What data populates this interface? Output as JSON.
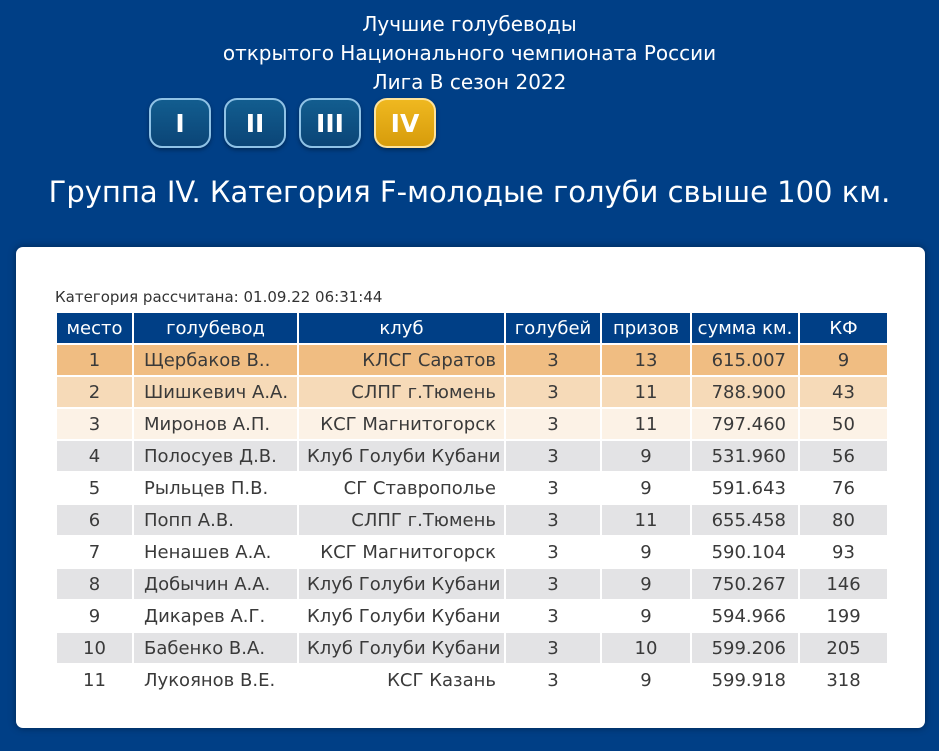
{
  "header": {
    "line1": "Лучшие голубеводы",
    "line2": "открытого Национального чемпионата России",
    "line3": "Лига В сезон 2022"
  },
  "groups": [
    {
      "label": "I",
      "active": false
    },
    {
      "label": "II",
      "active": false
    },
    {
      "label": "III",
      "active": false
    },
    {
      "label": "IV",
      "active": true
    }
  ],
  "subtitle": "Группа IV. Категория F-молодые голуби свыше 100 км.",
  "calculated": "Категория рассчитана: 01.09.22 06:31:44",
  "table": {
    "columns": [
      "место",
      "голубевод",
      "клуб",
      "голубей",
      "призов",
      "сумма км.",
      "КФ"
    ],
    "rows": [
      [
        "1",
        "Щербаков В..",
        "КЛСГ Саратов",
        "3",
        "13",
        "615.007",
        "9"
      ],
      [
        "2",
        "Шишкевич А.А.",
        "СЛПГ г.Тюмень",
        "3",
        "11",
        "788.900",
        "43"
      ],
      [
        "3",
        "Миронов А.П.",
        "КСГ Магнитогорск",
        "3",
        "11",
        "797.460",
        "50"
      ],
      [
        "4",
        "Полосуев Д.В.",
        "Клуб Голуби Кубани",
        "3",
        "9",
        "531.960",
        "56"
      ],
      [
        "5",
        "Рыльцев П.В.",
        "СГ Ставрополье",
        "3",
        "9",
        "591.643",
        "76"
      ],
      [
        "6",
        "Попп А.В.",
        "СЛПГ г.Тюмень",
        "3",
        "11",
        "655.458",
        "80"
      ],
      [
        "7",
        "Ненашев А.А.",
        "КСГ Магнитогорск",
        "3",
        "9",
        "590.104",
        "93"
      ],
      [
        "8",
        "Добычин А.А.",
        "Клуб Голуби Кубани",
        "3",
        "9",
        "750.267",
        "146"
      ],
      [
        "9",
        "Дикарев А.Г.",
        "Клуб Голуби Кубани",
        "3",
        "9",
        "594.966",
        "199"
      ],
      [
        "10",
        "Бабенко В.А.",
        "Клуб Голуби Кубани",
        "3",
        "10",
        "599.206",
        "205"
      ],
      [
        "11",
        "Лукоянов В.Е.",
        "КСГ Казань",
        "3",
        "9",
        "599.918",
        "318"
      ]
    ]
  },
  "colors": {
    "background": "#003f86",
    "active_group": "#e3a912",
    "row1": "#f0bd82",
    "row2": "#f6dab8",
    "row3": "#fcf2e6",
    "row_alt": "#e3e3e5"
  }
}
